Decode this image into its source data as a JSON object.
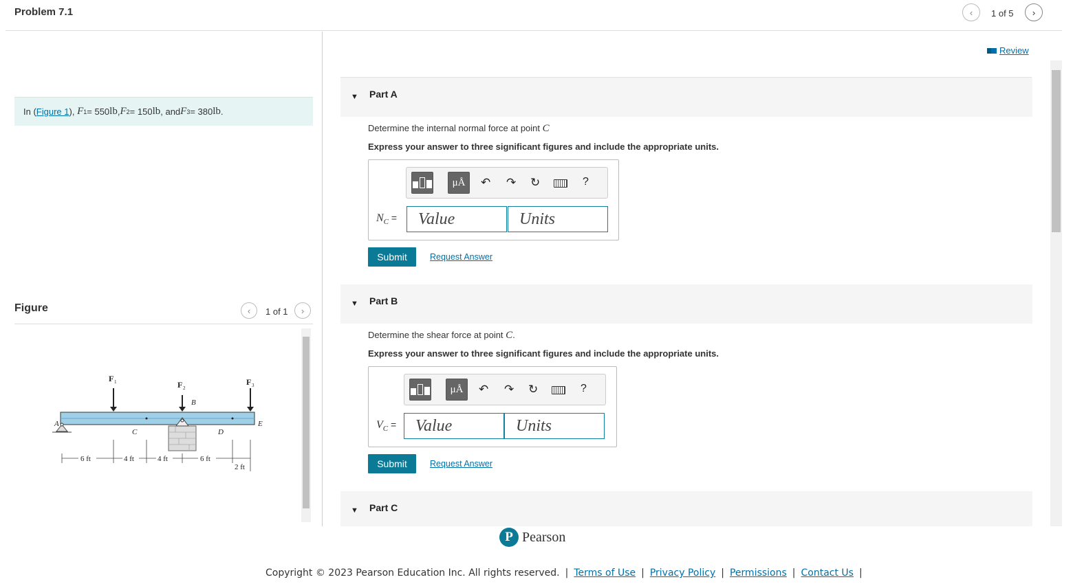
{
  "header": {
    "title": "Problem 7.1",
    "pager": {
      "text": "1 of 5",
      "prev_icon": "chevron-left-icon",
      "next_icon": "chevron-right-icon"
    }
  },
  "statement": {
    "prefix": "In (",
    "link": "Figure 1",
    "suffix": "),",
    "F1_sym": "F",
    "F1_sub": "1",
    "F1_val": " = 550 ",
    "F2_sym": "F",
    "F2_sub": "2",
    "F2_val": " = 150 ",
    "F3_sym": "F",
    "F3_sub": "3",
    "F3_val": " = 380 ",
    "unit": "lb",
    "and": ", and ",
    "comma": ", ",
    "period": "."
  },
  "figure": {
    "label": "Figure",
    "pager": "1 of 1",
    "labels": {
      "F1": "F",
      "F1s": "1",
      "F2": "F",
      "F2s": "2",
      "F3": "F",
      "F3s": "3",
      "A": "A",
      "B": "B",
      "C": "C",
      "D": "D",
      "E": "E",
      "d1": "6 ft",
      "d2": "4 ft",
      "d3": "4 ft",
      "d4": "6 ft",
      "d5": "2 ft"
    }
  },
  "review": {
    "label": "Review",
    "icon": "book-icon"
  },
  "toolbar": {
    "templates_icon": "templates-icon",
    "units_label": "μÅ",
    "undo_icon": "undo-icon",
    "redo_icon": "redo-icon",
    "reset_icon": "reset-icon",
    "keyboard_icon": "keyboard-icon",
    "help_label": "?"
  },
  "parts": [
    {
      "title": "Part A",
      "question_prefix": "Determine the internal normal force at point ",
      "question_point": "C",
      "question_suffix": "",
      "instruction": "Express your answer to three significant figures and include the appropriate units.",
      "var": "N",
      "var_sub": "C",
      "eq": " =",
      "value_placeholder": "Value",
      "units_placeholder": "Units",
      "submit": "Submit",
      "request": "Request Answer"
    },
    {
      "title": "Part B",
      "question_prefix": "Determine the shear force at point ",
      "question_point": "C",
      "question_suffix": ".",
      "instruction": "Express your answer to three significant figures and include the appropriate units.",
      "var": "V",
      "var_sub": "C",
      "eq": " =",
      "value_placeholder": "Value",
      "units_placeholder": "Units",
      "submit": "Submit",
      "request": "Request Answer"
    },
    {
      "title": "Part C"
    }
  ],
  "footer": {
    "logo_letter": "P",
    "logo_word": "Pearson",
    "copyright": "Copyright © 2023 Pearson Education Inc. All rights reserved.",
    "links": [
      "Terms of Use",
      "Privacy Policy",
      "Permissions",
      "Contact Us"
    ],
    "separator": "|"
  },
  "colors": {
    "accent": "#0b7a96",
    "link": "#0070a8",
    "statement_bg": "#e6f4f4",
    "beam": "#9fd0e8"
  }
}
